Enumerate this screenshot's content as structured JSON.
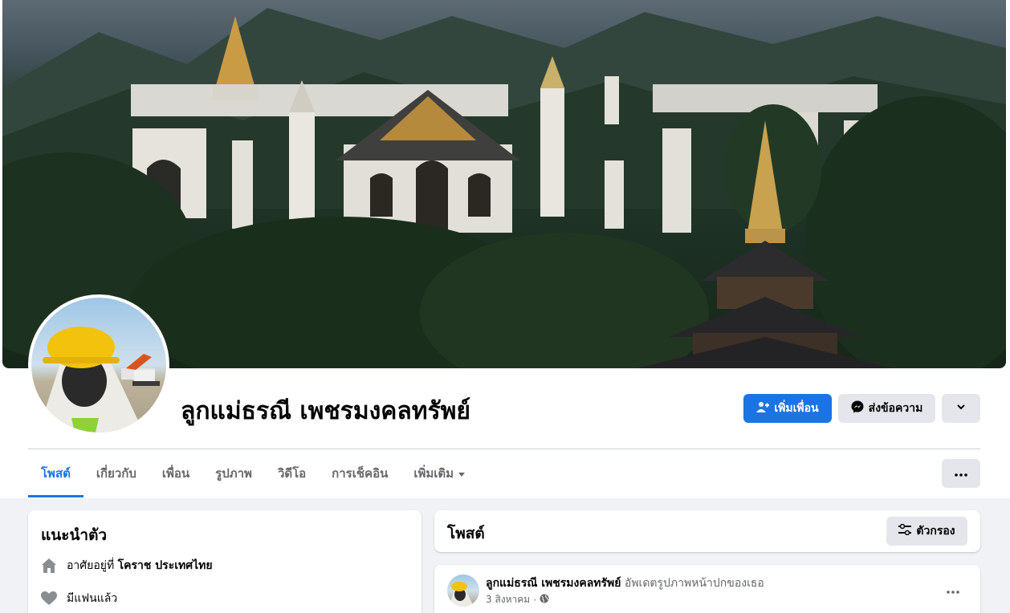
{
  "profile": {
    "name": "ลูกแม่ธรณี เพชรมงคลทรัพย์"
  },
  "actions": {
    "add_friend": "เพิ่มเพื่อน",
    "message": "ส่งข้อความ"
  },
  "tabs": [
    {
      "label": "โพสต์",
      "active": true
    },
    {
      "label": "เกี่ยวกับ"
    },
    {
      "label": "เพื่อน"
    },
    {
      "label": "รูปภาพ"
    },
    {
      "label": "วิดีโอ"
    },
    {
      "label": "การเช็คอิน"
    },
    {
      "label": "เพิ่มเติม"
    }
  ],
  "intro": {
    "title": "แนะนำตัว",
    "lives_in_prefix": "อาศัยอยู่ที่",
    "lives_in_place": "โคราช ประเทศไทย",
    "relationship": "มีแฟนแล้ว"
  },
  "posts": {
    "title": "โพสต์",
    "filter_label": "ตัวกรอง"
  },
  "post": {
    "author": "ลูกแม่ธรณี เพชรมงคลทรัพย์",
    "action": "อัพเดตรูปภาพหน้าปกของเธอ",
    "date": "3 สิงหาคม",
    "dot": "·"
  },
  "colors": {
    "accent": "#1b74e4",
    "page_background": "#f0f2f5",
    "secondary_button": "#e4e6eb",
    "muted_text": "#65676b"
  },
  "icons": {
    "add_friend": "person-plus-icon",
    "message": "messenger-icon",
    "more": "chevron-down-icon",
    "home": "home-icon",
    "heart": "heart-icon",
    "filter": "filter-icon",
    "globe": "globe-icon",
    "dots": "more-dots-icon"
  }
}
